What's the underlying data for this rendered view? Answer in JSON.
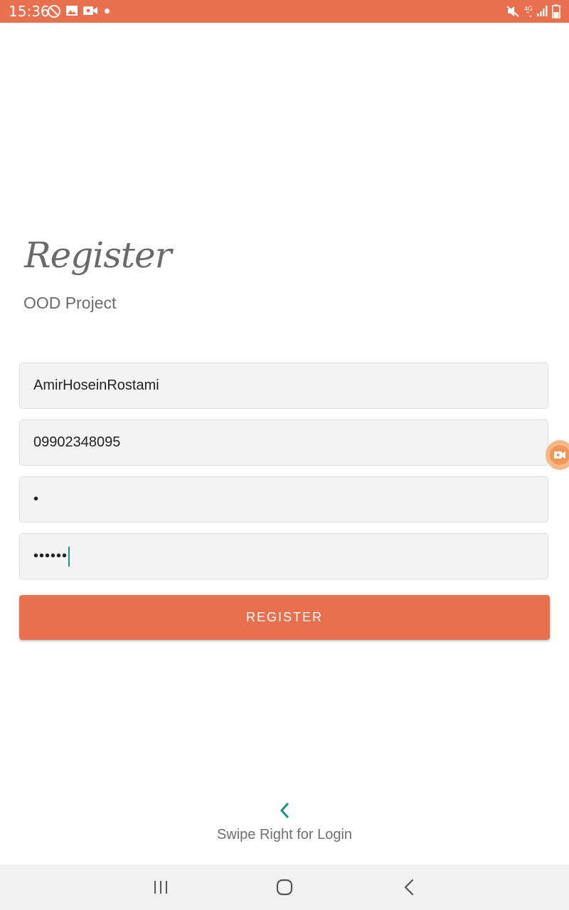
{
  "status_bar": {
    "time": "15:36",
    "icons_left": [
      "dnd-icon",
      "gallery-icon",
      "video-icon",
      "notification-dot"
    ],
    "icons_right": [
      "mute-icon",
      "4g-icon",
      "signal-icon",
      "battery-icon"
    ],
    "network_label": "4G",
    "background": "#e8704f"
  },
  "header": {
    "title": "Register",
    "subtitle": "OOD Project"
  },
  "form": {
    "fields": [
      {
        "name": "username",
        "value": "AmirHoseinRostami"
      },
      {
        "name": "phone",
        "value": "09902348095"
      },
      {
        "name": "password",
        "value": "•"
      },
      {
        "name": "confirm_password",
        "value": "••••••"
      }
    ],
    "submit_label": "REGISTER"
  },
  "footer": {
    "swipe_hint": "Swipe Right for Login"
  },
  "colors": {
    "accent": "#e8704f",
    "teal": "#1e8f86",
    "field_bg": "#f3f3f3"
  }
}
